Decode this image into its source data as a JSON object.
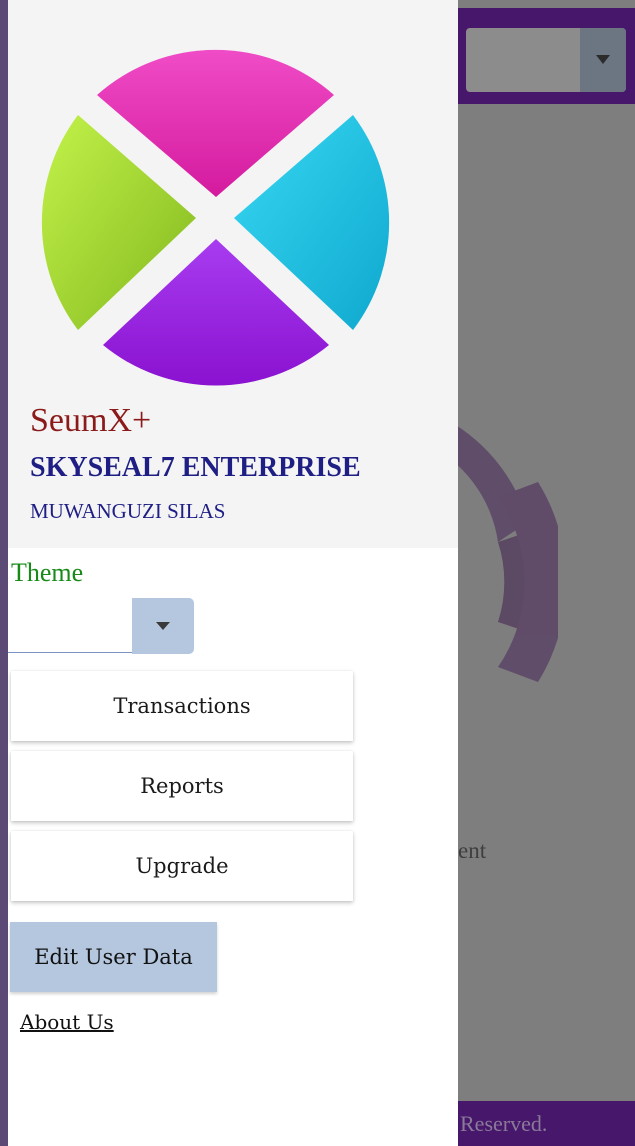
{
  "drawer": {
    "app_name": "SeumX+",
    "company_name": "SKYSEAL7 ENTERPRISE",
    "user_name": "MUWANGUZI SILAS",
    "logo": "quadrant-x-logo",
    "theme": {
      "label": "Theme",
      "selected_value": ""
    },
    "menu": {
      "transactions": "Transactions",
      "reports": "Reports",
      "upgrade": "Upgrade",
      "edit_user_data": "Edit User Data",
      "about_us": "About Us"
    }
  },
  "background_app": {
    "header_select_value": "",
    "content_text_fragment": "ent",
    "footer_text_fragment": "Reserved."
  },
  "colors": {
    "header_purple": "#46176a",
    "logo_magenta": "#e633b8",
    "logo_cyan": "#1cc1e0",
    "logo_lime": "#9bd43a",
    "logo_violet": "#9b1fd9",
    "app_name": "#8b1a1a",
    "company_name": "#1e1e85",
    "theme_label": "#178a17",
    "accent_button": "#b5c7de",
    "overlay_gray": "#7e7e7e"
  }
}
